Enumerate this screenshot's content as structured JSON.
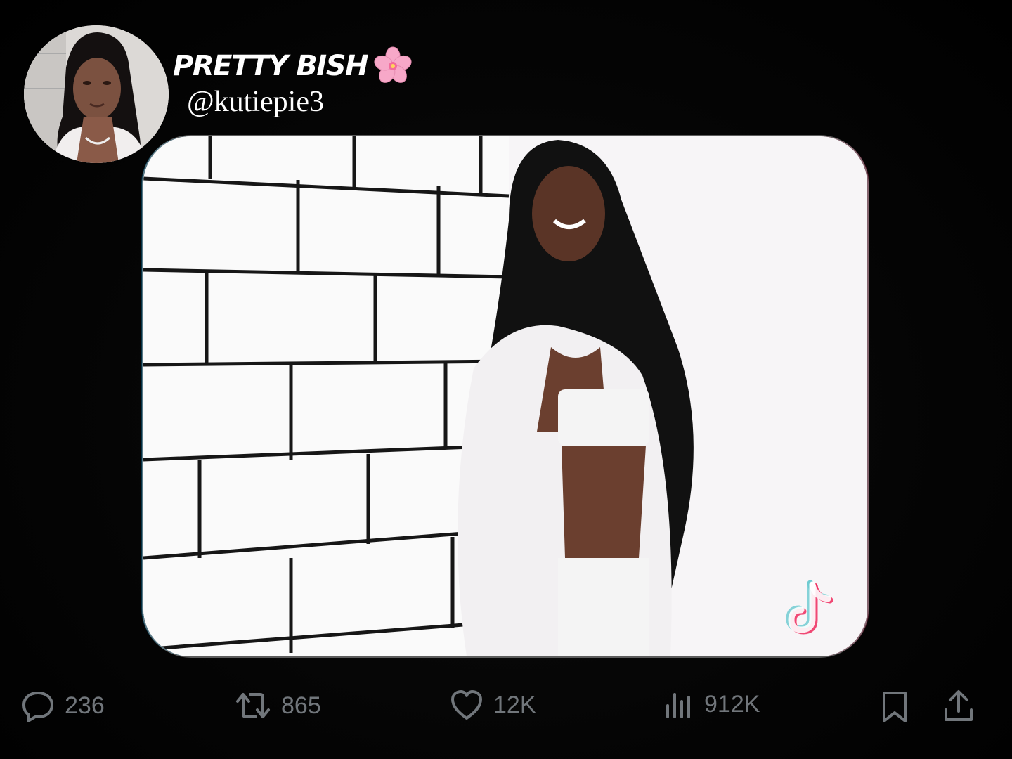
{
  "profile": {
    "display_name": "PRETTY BISH",
    "display_name_emoji": "cherry-blossom-icon",
    "handle": "@kutiepie3"
  },
  "media": {
    "watermark_icon": "tiktok-icon"
  },
  "actions": {
    "reply_count": "236",
    "repost_count": "865",
    "like_count": "12K",
    "views_count": "912K",
    "icons": [
      "reply-icon",
      "repost-icon",
      "like-icon",
      "views-icon",
      "bookmark-icon",
      "share-icon"
    ]
  },
  "colors": {
    "background": "#000000",
    "text_primary": "#ffffff",
    "text_secondary": "#71767b",
    "flower_pink": "#f7a8c8"
  }
}
